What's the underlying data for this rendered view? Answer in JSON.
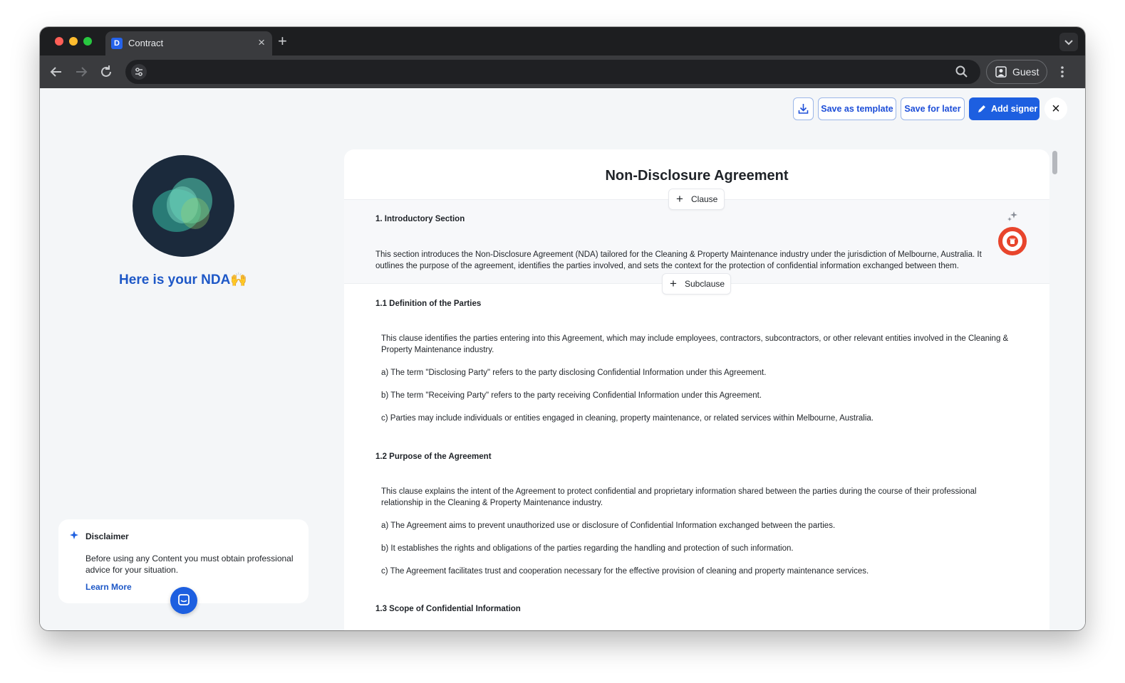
{
  "browser": {
    "tab_title": "Contract",
    "favicon_letter": "D",
    "new_tab": "+",
    "close_tab": "×",
    "address": "",
    "profile_label": "Guest"
  },
  "toolbar": {
    "save_template": "Save as template",
    "save_later": "Save for later",
    "add_signer": "Add signer",
    "close": "×"
  },
  "left": {
    "headline": "Here is your NDA🙌",
    "disclaimer_title": "Disclaimer",
    "disclaimer_body": "Before using any Content you must obtain professional advice for your situation.",
    "learn_more": "Learn More"
  },
  "doc": {
    "title": "Non-Disclosure Agreement",
    "add_clause": "Clause",
    "add_subclause": "Subclause",
    "plus": "+",
    "sections": [
      {
        "heading": "1. Introductory Section",
        "paras": [
          "This section introduces the Non-Disclosure Agreement (NDA) tailored for the Cleaning & Property Maintenance industry under the jurisdiction of Melbourne, Australia. It outlines the purpose of the agreement, identifies the parties involved, and sets the context for the protection of confidential information exchanged between them."
        ]
      },
      {
        "heading": "1.1 Definition of the Parties",
        "paras": [
          "This clause identifies the parties entering into this Agreement, which may include employees, contractors, subcontractors, or other relevant entities involved in the Cleaning & Property Maintenance industry.",
          "a) The term \"Disclosing Party\" refers to the party disclosing Confidential Information under this Agreement.",
          "b) The term \"Receiving Party\" refers to the party receiving Confidential Information under this Agreement.",
          "c) Parties may include individuals or entities engaged in cleaning, property maintenance, or related services within Melbourne, Australia."
        ]
      },
      {
        "heading": "1.2 Purpose of the Agreement",
        "paras": [
          "This clause explains the intent of the Agreement to protect confidential and proprietary information shared between the parties during the course of their professional relationship in the Cleaning & Property Maintenance industry.",
          "a) The Agreement aims to prevent unauthorized use or disclosure of Confidential Information exchanged between the parties.",
          "b) It establishes the rights and obligations of the parties regarding the handling and protection of such information.",
          "c) The Agreement facilitates trust and cooperation necessary for the effective provision of cleaning and property maintenance services."
        ]
      },
      {
        "heading": "1.3 Scope of Confidential Information",
        "paras": []
      }
    ]
  },
  "colors": {
    "accent": "#1d5fe0",
    "danger": "#e8452c",
    "page_bg": "#f4f6f8"
  }
}
